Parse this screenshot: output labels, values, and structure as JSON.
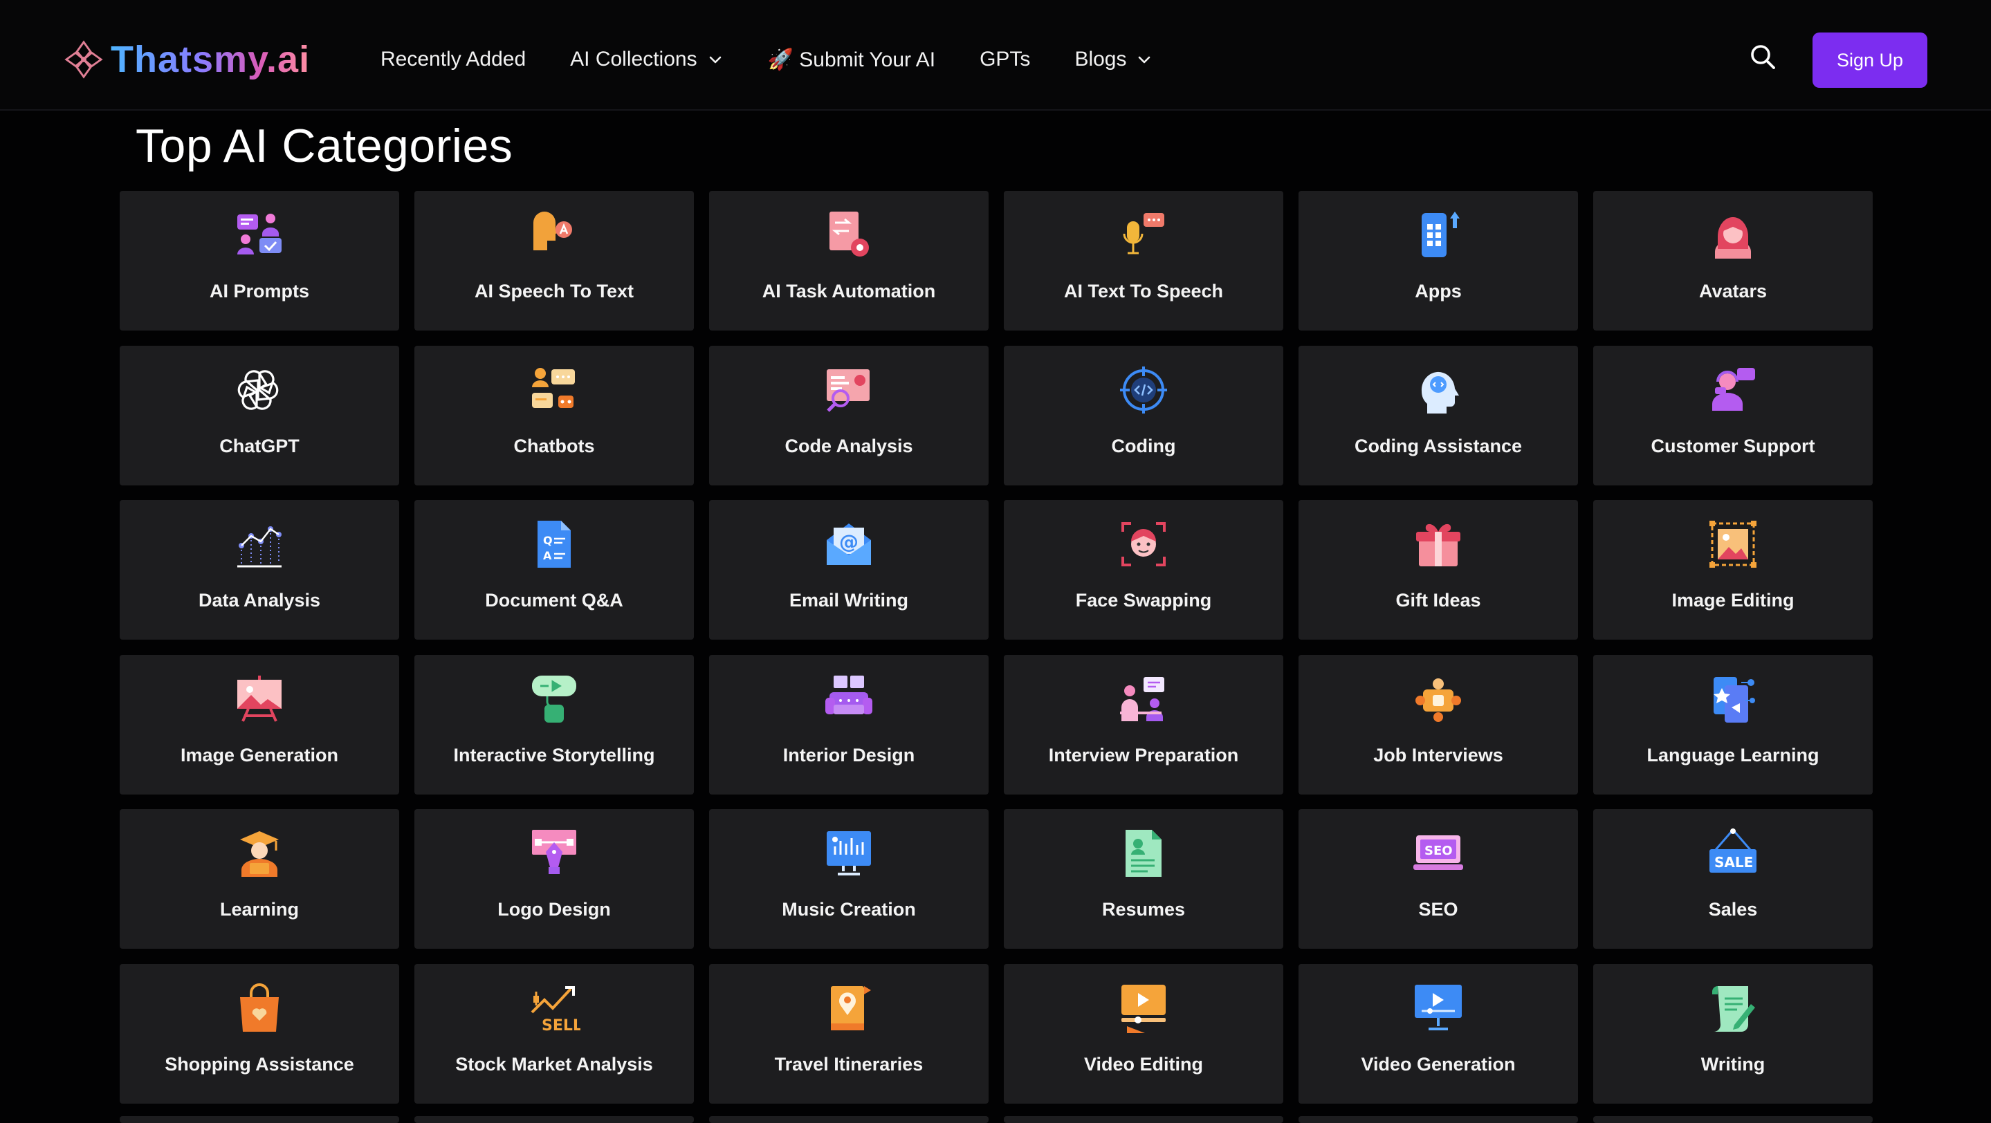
{
  "header": {
    "logo_text": "Thatsmy.ai",
    "nav": [
      {
        "label": "Recently Added",
        "has_dropdown": false
      },
      {
        "label": "AI Collections",
        "has_dropdown": true
      },
      {
        "label": "🚀 Submit Your AI",
        "has_dropdown": false
      },
      {
        "label": "GPTs",
        "has_dropdown": false
      },
      {
        "label": "Blogs",
        "has_dropdown": true
      }
    ],
    "signup_label": "Sign Up",
    "accent_color": "#7c2df0"
  },
  "main": {
    "title": "Top AI Categories",
    "categories": [
      {
        "label": "AI Prompts",
        "icon": "prompts-icon"
      },
      {
        "label": "AI Speech To Text",
        "icon": "speech-to-text-icon"
      },
      {
        "label": "AI Task Automation",
        "icon": "task-automation-icon"
      },
      {
        "label": "AI Text To Speech",
        "icon": "text-to-speech-icon"
      },
      {
        "label": "Apps",
        "icon": "apps-icon"
      },
      {
        "label": "Avatars",
        "icon": "avatar-icon"
      },
      {
        "label": "ChatGPT",
        "icon": "chatgpt-icon"
      },
      {
        "label": "Chatbots",
        "icon": "chatbot-icon"
      },
      {
        "label": "Code Analysis",
        "icon": "code-analysis-icon"
      },
      {
        "label": "Coding",
        "icon": "coding-icon"
      },
      {
        "label": "Coding Assistance",
        "icon": "coding-assistance-icon"
      },
      {
        "label": "Customer Support",
        "icon": "customer-support-icon"
      },
      {
        "label": "Data Analysis",
        "icon": "data-analysis-icon"
      },
      {
        "label": "Document Q&A",
        "icon": "document-qa-icon"
      },
      {
        "label": "Email Writing",
        "icon": "email-icon"
      },
      {
        "label": "Face Swapping",
        "icon": "face-swap-icon"
      },
      {
        "label": "Gift Ideas",
        "icon": "gift-icon"
      },
      {
        "label": "Image Editing",
        "icon": "image-editing-icon"
      },
      {
        "label": "Image Generation",
        "icon": "image-generation-icon"
      },
      {
        "label": "Interactive Storytelling",
        "icon": "storytelling-icon"
      },
      {
        "label": "Interior Design",
        "icon": "sofa-icon"
      },
      {
        "label": "Interview Preparation",
        "icon": "interview-icon"
      },
      {
        "label": "Job Interviews",
        "icon": "job-interview-icon"
      },
      {
        "label": "Language Learning",
        "icon": "language-learning-icon"
      },
      {
        "label": "Learning",
        "icon": "graduate-icon"
      },
      {
        "label": "Logo Design",
        "icon": "logo-design-icon"
      },
      {
        "label": "Music Creation",
        "icon": "music-creation-icon"
      },
      {
        "label": "Resumes",
        "icon": "resume-icon"
      },
      {
        "label": "SEO",
        "icon": "seo-icon"
      },
      {
        "label": "Sales",
        "icon": "sale-sign-icon"
      },
      {
        "label": "Shopping Assistance",
        "icon": "shopping-bag-icon"
      },
      {
        "label": "Stock Market Analysis",
        "icon": "stock-sell-icon"
      },
      {
        "label": "Travel Itineraries",
        "icon": "travel-map-icon"
      },
      {
        "label": "Video Editing",
        "icon": "video-editing-icon"
      },
      {
        "label": "Video Generation",
        "icon": "video-generation-icon"
      },
      {
        "label": "Writing",
        "icon": "writing-icon"
      }
    ]
  }
}
